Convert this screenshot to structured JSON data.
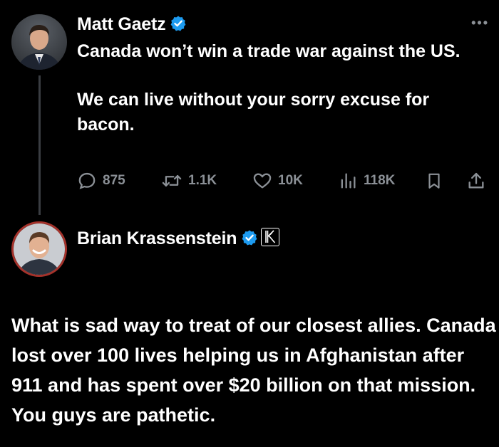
{
  "colors": {
    "background": "#000000",
    "text": "#ffffff",
    "muted": "#8b9096",
    "verified": "#1d9bf0",
    "thread_line": "#3a3d42",
    "avatar_ring": "#a5322b"
  },
  "tweet": {
    "author": "Matt Gaetz",
    "verified_icon": "verified-badge-icon",
    "more_icon": "more-options-icon",
    "text_lines": [
      "Canada won’t win a trade war against the US.",
      "We can live without your sorry excuse for bacon."
    ],
    "actions": {
      "replies": "875",
      "reposts": "1.1K",
      "likes": "10K",
      "views": "118K"
    }
  },
  "reply": {
    "author": "Brian Krassenstein",
    "verified_icon": "verified-badge-icon",
    "affiliate_icon": "k-affiliate-badge-icon",
    "text": "What is sad way to treat of our closest allies. Canada lost over 100 lives helping us in Afghanistan after 911 and has spent over $20 billion on that mission. You guys are pathetic."
  }
}
